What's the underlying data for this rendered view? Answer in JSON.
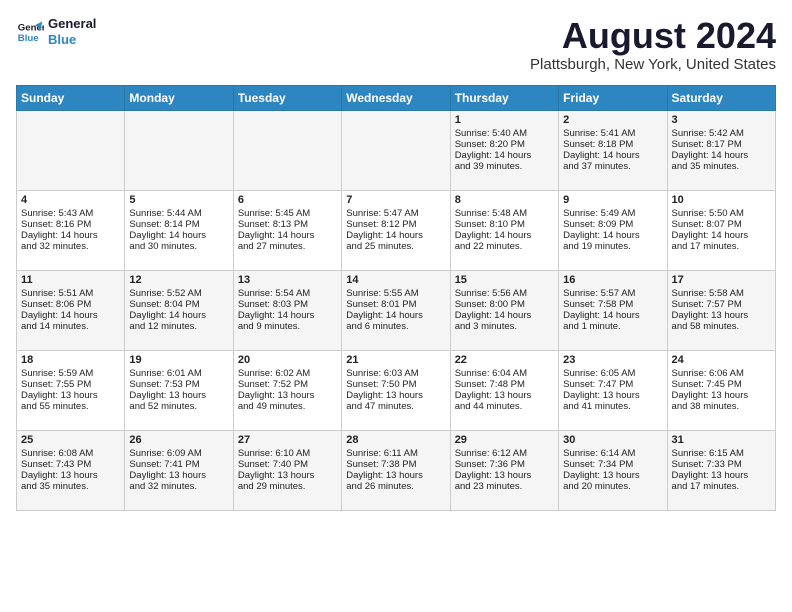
{
  "header": {
    "logo_line1": "General",
    "logo_line2": "Blue",
    "title": "August 2024",
    "subtitle": "Plattsburgh, New York, United States"
  },
  "days_of_week": [
    "Sunday",
    "Monday",
    "Tuesday",
    "Wednesday",
    "Thursday",
    "Friday",
    "Saturday"
  ],
  "weeks": [
    [
      {
        "day": "",
        "content": ""
      },
      {
        "day": "",
        "content": ""
      },
      {
        "day": "",
        "content": ""
      },
      {
        "day": "",
        "content": ""
      },
      {
        "day": "1",
        "content": "Sunrise: 5:40 AM\nSunset: 8:20 PM\nDaylight: 14 hours\nand 39 minutes."
      },
      {
        "day": "2",
        "content": "Sunrise: 5:41 AM\nSunset: 8:18 PM\nDaylight: 14 hours\nand 37 minutes."
      },
      {
        "day": "3",
        "content": "Sunrise: 5:42 AM\nSunset: 8:17 PM\nDaylight: 14 hours\nand 35 minutes."
      }
    ],
    [
      {
        "day": "4",
        "content": "Sunrise: 5:43 AM\nSunset: 8:16 PM\nDaylight: 14 hours\nand 32 minutes."
      },
      {
        "day": "5",
        "content": "Sunrise: 5:44 AM\nSunset: 8:14 PM\nDaylight: 14 hours\nand 30 minutes."
      },
      {
        "day": "6",
        "content": "Sunrise: 5:45 AM\nSunset: 8:13 PM\nDaylight: 14 hours\nand 27 minutes."
      },
      {
        "day": "7",
        "content": "Sunrise: 5:47 AM\nSunset: 8:12 PM\nDaylight: 14 hours\nand 25 minutes."
      },
      {
        "day": "8",
        "content": "Sunrise: 5:48 AM\nSunset: 8:10 PM\nDaylight: 14 hours\nand 22 minutes."
      },
      {
        "day": "9",
        "content": "Sunrise: 5:49 AM\nSunset: 8:09 PM\nDaylight: 14 hours\nand 19 minutes."
      },
      {
        "day": "10",
        "content": "Sunrise: 5:50 AM\nSunset: 8:07 PM\nDaylight: 14 hours\nand 17 minutes."
      }
    ],
    [
      {
        "day": "11",
        "content": "Sunrise: 5:51 AM\nSunset: 8:06 PM\nDaylight: 14 hours\nand 14 minutes."
      },
      {
        "day": "12",
        "content": "Sunrise: 5:52 AM\nSunset: 8:04 PM\nDaylight: 14 hours\nand 12 minutes."
      },
      {
        "day": "13",
        "content": "Sunrise: 5:54 AM\nSunset: 8:03 PM\nDaylight: 14 hours\nand 9 minutes."
      },
      {
        "day": "14",
        "content": "Sunrise: 5:55 AM\nSunset: 8:01 PM\nDaylight: 14 hours\nand 6 minutes."
      },
      {
        "day": "15",
        "content": "Sunrise: 5:56 AM\nSunset: 8:00 PM\nDaylight: 14 hours\nand 3 minutes."
      },
      {
        "day": "16",
        "content": "Sunrise: 5:57 AM\nSunset: 7:58 PM\nDaylight: 14 hours\nand 1 minute."
      },
      {
        "day": "17",
        "content": "Sunrise: 5:58 AM\nSunset: 7:57 PM\nDaylight: 13 hours\nand 58 minutes."
      }
    ],
    [
      {
        "day": "18",
        "content": "Sunrise: 5:59 AM\nSunset: 7:55 PM\nDaylight: 13 hours\nand 55 minutes."
      },
      {
        "day": "19",
        "content": "Sunrise: 6:01 AM\nSunset: 7:53 PM\nDaylight: 13 hours\nand 52 minutes."
      },
      {
        "day": "20",
        "content": "Sunrise: 6:02 AM\nSunset: 7:52 PM\nDaylight: 13 hours\nand 49 minutes."
      },
      {
        "day": "21",
        "content": "Sunrise: 6:03 AM\nSunset: 7:50 PM\nDaylight: 13 hours\nand 47 minutes."
      },
      {
        "day": "22",
        "content": "Sunrise: 6:04 AM\nSunset: 7:48 PM\nDaylight: 13 hours\nand 44 minutes."
      },
      {
        "day": "23",
        "content": "Sunrise: 6:05 AM\nSunset: 7:47 PM\nDaylight: 13 hours\nand 41 minutes."
      },
      {
        "day": "24",
        "content": "Sunrise: 6:06 AM\nSunset: 7:45 PM\nDaylight: 13 hours\nand 38 minutes."
      }
    ],
    [
      {
        "day": "25",
        "content": "Sunrise: 6:08 AM\nSunset: 7:43 PM\nDaylight: 13 hours\nand 35 minutes."
      },
      {
        "day": "26",
        "content": "Sunrise: 6:09 AM\nSunset: 7:41 PM\nDaylight: 13 hours\nand 32 minutes."
      },
      {
        "day": "27",
        "content": "Sunrise: 6:10 AM\nSunset: 7:40 PM\nDaylight: 13 hours\nand 29 minutes."
      },
      {
        "day": "28",
        "content": "Sunrise: 6:11 AM\nSunset: 7:38 PM\nDaylight: 13 hours\nand 26 minutes."
      },
      {
        "day": "29",
        "content": "Sunrise: 6:12 AM\nSunset: 7:36 PM\nDaylight: 13 hours\nand 23 minutes."
      },
      {
        "day": "30",
        "content": "Sunrise: 6:14 AM\nSunset: 7:34 PM\nDaylight: 13 hours\nand 20 minutes."
      },
      {
        "day": "31",
        "content": "Sunrise: 6:15 AM\nSunset: 7:33 PM\nDaylight: 13 hours\nand 17 minutes."
      }
    ]
  ]
}
